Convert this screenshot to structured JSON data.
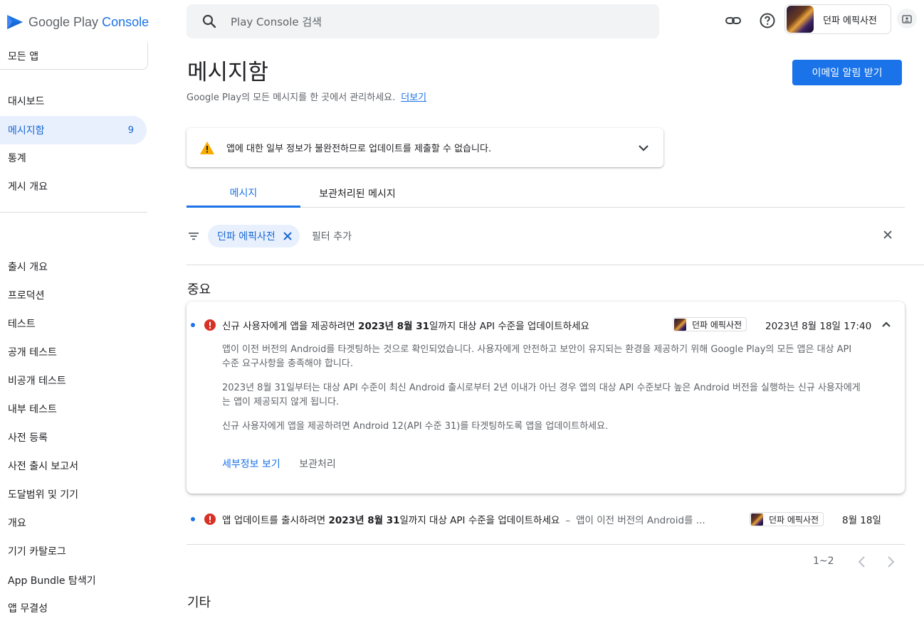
{
  "header": {
    "logo_text_prefix": "Google Play",
    "logo_text_suffix": "Console",
    "search_placeholder": "Play Console 검색",
    "app_name": "던파 에픽사전"
  },
  "sidebar": {
    "all_apps": "모든 앱",
    "items": [
      {
        "label": "대시보드"
      },
      {
        "label": "메시지함",
        "count": "9",
        "active": true
      },
      {
        "label": "통계"
      },
      {
        "label": "게시 개요"
      },
      {
        "label": "출시 개요"
      },
      {
        "label": "프로덕션"
      },
      {
        "label": "테스트"
      },
      {
        "label": "공개 테스트"
      },
      {
        "label": "비공개 테스트"
      },
      {
        "label": "내부 테스트"
      },
      {
        "label": "사전 등록"
      },
      {
        "label": "사전 출시 보고서"
      },
      {
        "label": "도달범위 및 기기"
      },
      {
        "label": "개요"
      },
      {
        "label": "기기 카탈로그"
      },
      {
        "label": "App Bundle 탐색기"
      },
      {
        "label": "앱 무결성"
      }
    ]
  },
  "main": {
    "title": "메시지함",
    "subtitle": "Google Play의 모든 메시지를 한 곳에서 관리하세요.",
    "learn_more": "더보기",
    "email_button": "이메일 알림 받기",
    "warning": "앱에 대한 일부 정보가 불완전하므로 업데이트를 제출할 수 없습니다.",
    "tabs": [
      {
        "label": "메시지",
        "active": true
      },
      {
        "label": "보관처리된 메시지",
        "active": false
      }
    ],
    "filter": {
      "chip_label": "던파 에픽사전",
      "add_filter": "필터 추가"
    },
    "section_important": "중요",
    "section_other": "기타",
    "messages": [
      {
        "title_pre": "신규 사용자에게 앱을 제공하려면 ",
        "title_bold": "2023년 8월 31",
        "title_post": "일까지 대상 API 수준을 업데이트하세요",
        "app": "던파 에픽사전",
        "date": "2023년 8월 18일 17:40",
        "body": [
          "앱이 이전 버전의 Android를 타겟팅하는 것으로 확인되었습니다. 사용자에게 안전하고 보안이 유지되는 환경을 제공하기 위해 Google Play의 모든 앱은 대상 API 수준 요구사항을 충족해야 합니다.",
          "2023년 8월 31일부터는 대상 API 수준이 최신 Android 출시로부터 2년 이내가 아닌 경우 앱의 대상 API 수준보다 높은 Android 버전을 실행하는 신규 사용자에게는 앱이 제공되지 않게 됩니다.",
          "신규 사용자에게 앱을 제공하려면 Android 12(API 수준 31)를 타겟팅하도록 앱을 업데이트하세요."
        ],
        "action_details": "세부정보 보기",
        "action_archive": "보관처리"
      },
      {
        "title_pre": "앱 업데이트를 출시하려면 ",
        "title_bold": "2023년 8월 31",
        "title_post": "일까지 대상 API 수준을 업데이트하세요",
        "separator": "–",
        "snippet": "앱이 이전 버전의 Android를 ...",
        "app": "던파 에픽사전",
        "date": "8월 18일"
      }
    ],
    "pagination": "1~2"
  },
  "colors": {
    "accent": "#1a73e8",
    "error": "#d93025",
    "warning": "#f9ab00",
    "active_nav_bg": "#e8f0fe"
  },
  "icons": [
    "play-console-logo-icon",
    "search-icon",
    "link-icon",
    "help-icon",
    "account-switch-icon",
    "warning-icon",
    "chevron-down-icon",
    "filter-icon",
    "close-icon",
    "error-icon",
    "chevron-up-icon",
    "chevron-left-icon",
    "chevron-right-icon"
  ]
}
